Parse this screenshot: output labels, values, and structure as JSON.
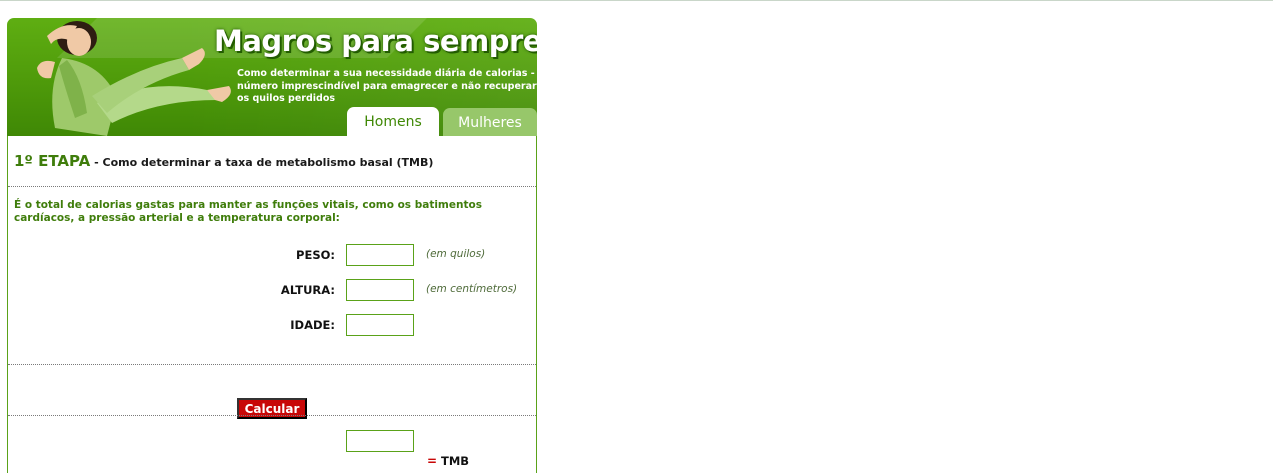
{
  "header": {
    "title": "Magros para sempre",
    "subtitle": "Como determinar a sua necessidade diária de calorias - número imprescindível para emagrecer e não recuperar os quilos perdidos"
  },
  "tabs": [
    {
      "label": "Homens",
      "active": true
    },
    {
      "label": "Mulheres",
      "active": false
    }
  ],
  "step": {
    "number": "1º ETAPA",
    "title": " - Como determinar a taxa de metabolismo basal (TMB)"
  },
  "intro": "É o total de calorias gastas para manter as funções vitais, como os batimentos cardíacos, a pressão arterial e a temperatura corporal:",
  "form": {
    "peso": {
      "label": "PESO:",
      "value": "",
      "hint": "(em quilos)"
    },
    "altura": {
      "label": "ALTURA:",
      "value": "",
      "hint": "(em centímetros)"
    },
    "idade": {
      "label": "IDADE:",
      "value": ""
    }
  },
  "calc_button": "Calcular",
  "result": {
    "value": "",
    "equals": "=",
    "label": "TMB"
  },
  "colors": {
    "header_green": "#4e9a0a",
    "text_green": "#3f7d0b",
    "button_red": "#c80707",
    "tab_inactive": "#97c76a"
  }
}
